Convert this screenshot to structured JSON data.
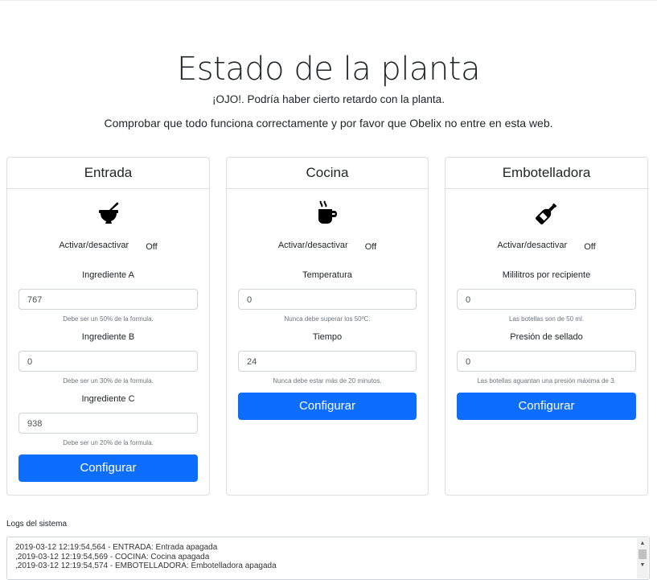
{
  "page": {
    "title": "Estado de la planta",
    "warning": "¡OJO!. Podría haber cierto retardo con la planta.",
    "lead": "Comprobar que todo funciona correctamente y por favor que Obelix no entre en esta web."
  },
  "cards": [
    {
      "title": "Entrada",
      "icon": "mortar-pestle-icon",
      "toggle_label": "Activar/desactivar",
      "toggle_state": "Off",
      "fields": [
        {
          "label": "Ingrediente A",
          "value": "767",
          "help": "Debe ser un 50% de la formula."
        },
        {
          "label": "Ingrediente B",
          "value": "0",
          "help": "Debe ser un 30% de la formula."
        },
        {
          "label": "Ingrediente C",
          "value": "938",
          "help": "Debe ser un 20% de la formula."
        }
      ],
      "button": "Configurar"
    },
    {
      "title": "Cocina",
      "icon": "mug-hot-icon",
      "toggle_label": "Activar/desactivar",
      "toggle_state": "Off",
      "fields": [
        {
          "label": "Temperatura",
          "value": "0",
          "help": "Nunca debe superar los 50ºC."
        },
        {
          "label": "Tiempo",
          "value": "24",
          "help": "Nunca debe estar más de 20 minutos."
        }
      ],
      "button": "Configurar"
    },
    {
      "title": "Embotelladora",
      "icon": "wine-bottle-icon",
      "toggle_label": "Activar/desactivar",
      "toggle_state": "Off",
      "fields": [
        {
          "label": "Mililitros por recipiente",
          "value": "0",
          "help": "Las botellas son de 50 ml."
        },
        {
          "label": "Presión de sellado",
          "value": "0",
          "help": "Las botellas aguantan una presión máxima de 3."
        }
      ],
      "button": "Configurar"
    }
  ],
  "logs": {
    "label": "Logs del sistema",
    "lines": [
      "2019-03-12 12:19:54,564 - ENTRADA: Entrada apagada",
      ",2019-03-12 12:19:54,569 - COCINA: Cocina apagada",
      ",2019-03-12 12:19:54,574 - EMBOTELLADORA: Embotelladora apagada"
    ]
  },
  "colors": {
    "primary": "#0d6efd",
    "border": "#dfdfdf",
    "text": "#212529"
  }
}
